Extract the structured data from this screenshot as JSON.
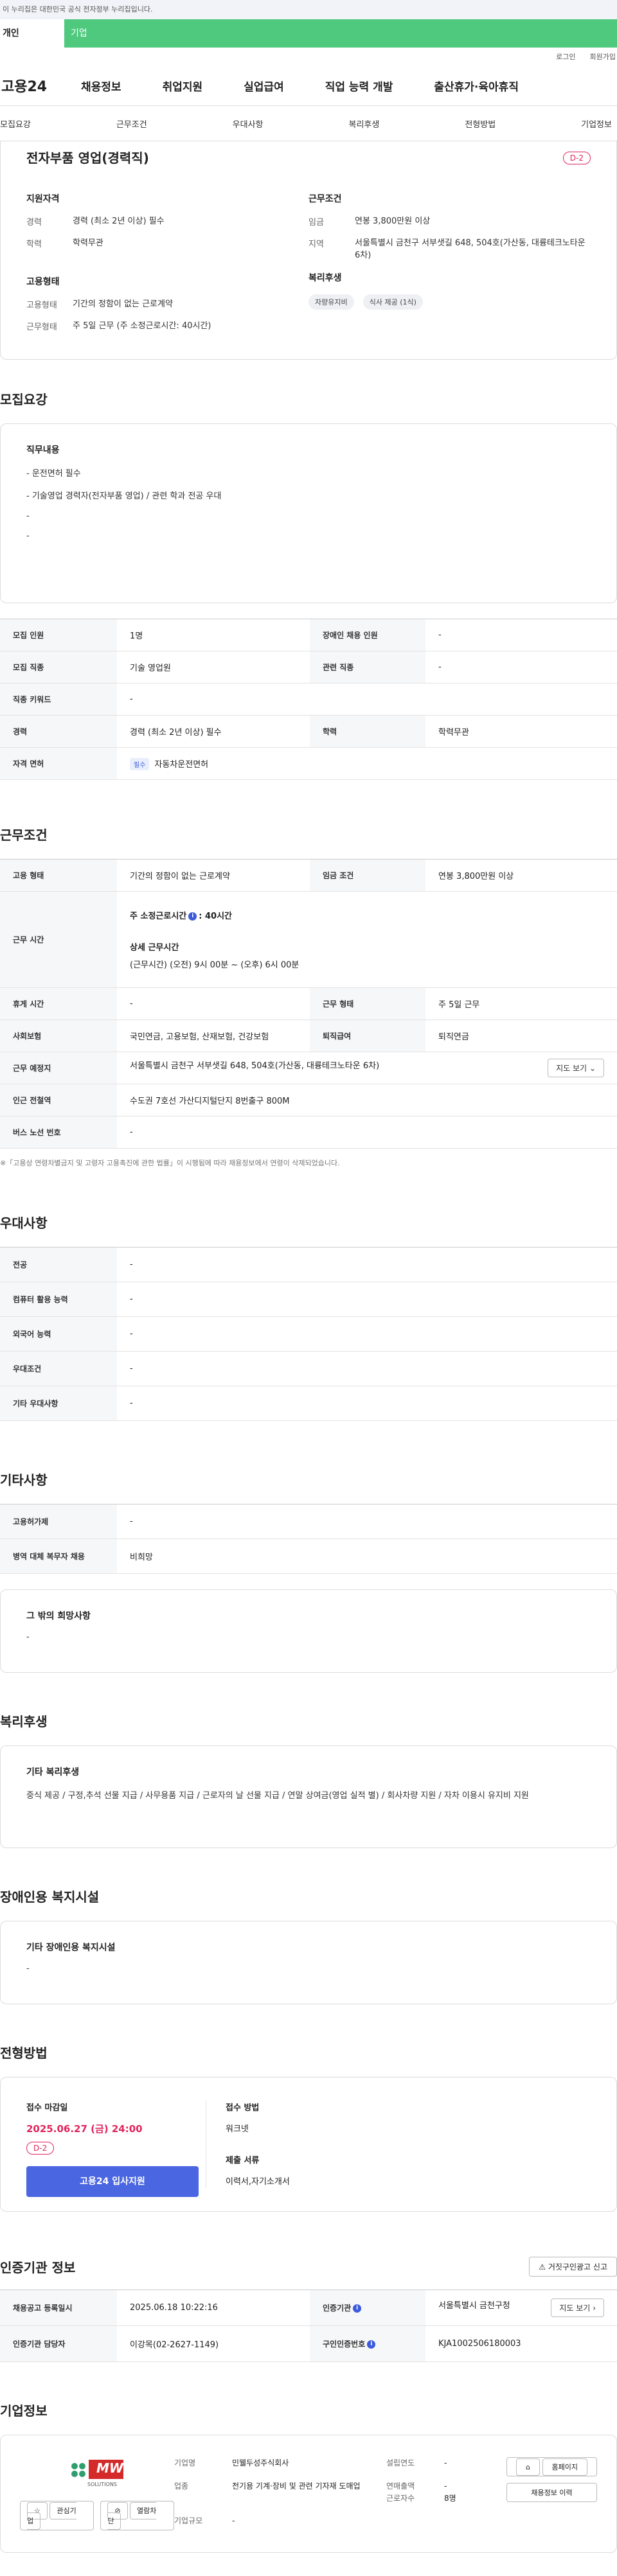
{
  "gov_banner": "이 누리집은 대한민국 공식 전자정부 누리집입니다.",
  "user_tabs": [
    "개인",
    "기업"
  ],
  "util_links": [
    "로그인",
    "회원가입"
  ],
  "logo": "고용24",
  "gnb": [
    "채용정보",
    "취업지원",
    "실업급여",
    "직업 능력 개발",
    "출산휴가·육아휴직"
  ],
  "subtabs": [
    "모집요강",
    "근무조건",
    "우대사항",
    "복리후생",
    "전형방법",
    "기업정보"
  ],
  "summary": {
    "title": "전자부품 영업(경력직)",
    "dday": "D-2",
    "qualification_head": "지원자격",
    "career_k": "경력",
    "career_v": "경력 (최소 2년 이상) 필수",
    "edu_k": "학력",
    "edu_v": "학력무관",
    "employ_head": "고용형태",
    "etype_k": "고용형태",
    "etype_v": "기간의 정함이 없는 근로계약",
    "wtime_k": "근무형태",
    "wtime_v": "주 5일 근무 (주 소정근로시간: 40시간)",
    "cond_head": "근무조건",
    "wage_k": "임금",
    "wage_v": "연봉 3,800만원 이상",
    "region_k": "지역",
    "region_v": "서울특별시 금천구 서부샛길 648, 504호(가산동, 대륭테크노타운 6차)",
    "welfare_head": "복리후생",
    "welfare_chips": [
      "자량유지비",
      "식사 제공 (1식)"
    ]
  },
  "recruit": {
    "heading": "모집요강",
    "box_title": "직무내용",
    "lines": [
      "- 운전면허 필수",
      "- 기술영업 경력자(전자부품 영업) / 관련 학과 전공 우대",
      "-",
      "-"
    ],
    "rows": {
      "count_k": "모집 인원",
      "count_v": "1명",
      "disabled_k": "장애인 채용 인원",
      "disabled_v": "-",
      "job_k": "모집 직종",
      "job_v": "기술 영업원",
      "related_k": "관련 직종",
      "related_v": "-",
      "keyword_k": "직종 키워드",
      "keyword_v": "-",
      "career_k": "경력",
      "career_v": "경력 (최소 2년 이상) 필수",
      "edu_k": "학력",
      "edu_v": "학력무관",
      "license_k": "자격 면허",
      "license_badge": "필수",
      "license_v": "자동차운전면허"
    }
  },
  "work": {
    "heading": "근무조건",
    "etype_k": "고용 형태",
    "etype_v": "기간의 정함이 없는 근로계약",
    "wage_k": "임금 조건",
    "wage_v": "연봉 3,800만원 이상",
    "time_k": "근무 시간",
    "time_weekly": "주 소정근로시간",
    "time_weekly_v": ": 40시간",
    "time_detail_h": "상세 근무시간",
    "time_detail_v": "(근무시간) (오전) 9시 00분 ~ (오후) 6시 00분",
    "rest_k": "휴게 시간",
    "rest_v": "-",
    "shape_k": "근무 형태",
    "shape_v": "주 5일 근무",
    "insure_k": "사회보험",
    "insure_v": "국민연금, 고용보험, 산재보험, 건강보험",
    "retire_k": "퇴직급여",
    "retire_v": "퇴직연금",
    "place_k": "근무 예정지",
    "place_v": "서울특별시 금천구 서부샛길 648, 504호(가산동, 대륭테크노타운 6차)",
    "map_btn": "지도 보기",
    "subway_k": "인근 전철역",
    "subway_v": "수도권 7호선 가산디지털단지 8번출구 800M",
    "bus_k": "버스 노선 번호",
    "bus_v": "-",
    "note": "※「고용상 연령차별금지 및 고령자 고용촉진에 관한 법률」이 시행됨에 따라 채용정보에서 연령이 삭제되었습니다."
  },
  "pref": {
    "heading": "우대사항",
    "rows": [
      {
        "k": "전공",
        "v": "-"
      },
      {
        "k": "컴퓨터 활용 능력",
        "v": "-"
      },
      {
        "k": "외국어 능력",
        "v": "-"
      },
      {
        "k": "우대조건",
        "v": "-"
      },
      {
        "k": "기타 우대사항",
        "v": "-"
      }
    ]
  },
  "etc": {
    "heading": "기타사항",
    "rows": [
      {
        "k": "고용허가제",
        "v": "-"
      },
      {
        "k": "병역 대체 복무자 채용",
        "v": "비희망"
      }
    ],
    "box_title": "그 밖의 희망사항",
    "box_v": "-"
  },
  "welfare": {
    "heading": "복리후생",
    "box_title": "기타 복리후생",
    "box_v": "중식 제공 / 구정,추석 선물 지급 / 사무용품 지급 / 근로자의 날 선물 지급 / 연말 상여금(영업 실적 별) / 회사차량 지원 / 자차 이용시 유지비 지원"
  },
  "disabled": {
    "heading": "장애인용 복지시설",
    "box_title": "기타 장애인용 복지시설",
    "box_v": "-"
  },
  "screening": {
    "heading": "전형방법",
    "deadline_h": "접수 마감일",
    "deadline_v": "2025.06.27 (금) 24:00",
    "dday": "D-2",
    "apply_btn": "고용24 입사지원",
    "method_h": "접수 방법",
    "method_v": "워크넷",
    "docs_h": "제출 서류",
    "docs_v": "이력서,자기소개서"
  },
  "agency": {
    "heading": "인증기관 정보",
    "report_btn": "거짓구인광고 신고",
    "reg_k": "채용공고 등록일시",
    "reg_v": "2025.06.18 10:22:16",
    "org_k": "인증기관",
    "org_v": "서울특별시 금천구청",
    "map_btn": "지도 보기",
    "manager_k": "인증기관 담당자",
    "manager_v": "이강목(02-2627-1149)",
    "num_k": "구인인증번호",
    "num_v": "KJA1002506180003"
  },
  "company": {
    "heading": "기업정보",
    "logo_text": "MW",
    "logo_sub": "SOLUTIONS",
    "fav_btn": "관심기업",
    "block_btn": "열람차단",
    "name_k": "기업명",
    "name_v": "민웰두성주식회사",
    "found_k": "설립연도",
    "found_v": "-",
    "biz_k": "업종",
    "biz_v": "전기용 기계·장비 및 관련 기자재 도매업",
    "sales_k": "연매출액",
    "sales_v": "-",
    "emp_k": "근로자수",
    "emp_v": "8명",
    "size_k": "기업규모",
    "size_v": "-",
    "home_btn": "홈페이지",
    "jobs_btn": "채용정보 이력"
  },
  "colors": {
    "accent": "#4a66e0",
    "dday": "#e0245e",
    "green": "#4ec97d"
  }
}
